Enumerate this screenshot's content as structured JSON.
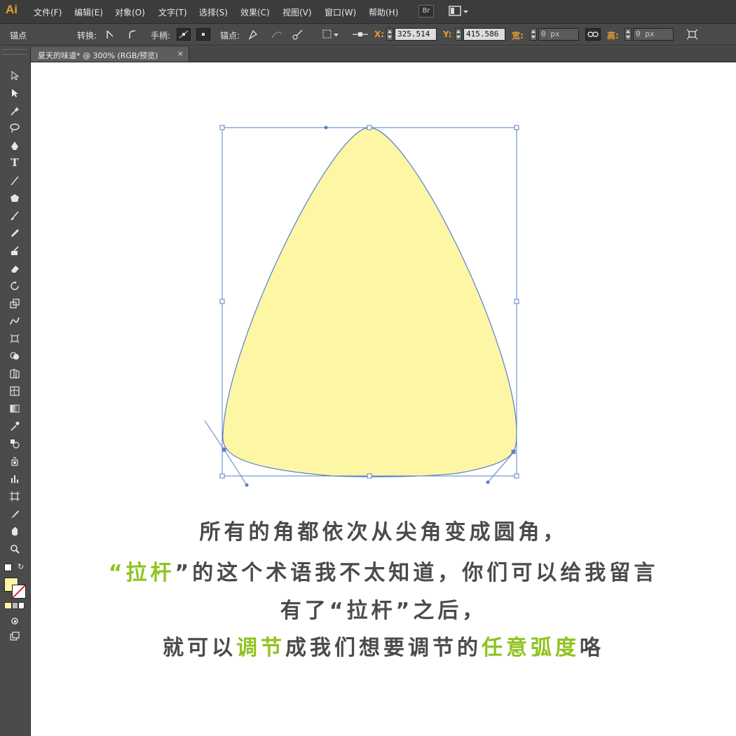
{
  "app": {
    "logo": "Ai",
    "bridge_label": "Br"
  },
  "menubar": {
    "items": [
      "文件(F)",
      "编辑(E)",
      "对象(O)",
      "文字(T)",
      "选择(S)",
      "效果(C)",
      "视图(V)",
      "窗口(W)",
      "帮助(H)"
    ]
  },
  "control_bar": {
    "anchor_label": "锚点",
    "convert_label": "转换:",
    "handles_label": "手柄:",
    "anchors_label": "锚点:",
    "x_label": "X:",
    "x_value": "325.514",
    "y_label": "Y:",
    "y_value": "415.586",
    "width_label": "宽:",
    "width_value": "0 px",
    "height_label": "高:",
    "height_value": "0 px"
  },
  "document_tab": {
    "title": "夏天的味道* @ 300% (RGB/预览)",
    "close": "×"
  },
  "colors": {
    "fill": "#fdf7a5",
    "stroke": "#5a7fcc",
    "accent": "#8fc31f",
    "caption": "#4b4b4b"
  },
  "caption": {
    "line1": "所有的角都依次从尖角变成圆角，",
    "line2": {
      "q_open": "“",
      "term": "拉杆",
      "q_close": "”",
      "rest": "的这个术语我不太知道，你们可以给我留言"
    },
    "line3": {
      "pre": "有了“",
      "term": "拉杆",
      "post": "”之后，"
    },
    "line4": {
      "pre": "就可以",
      "hl1": "调节",
      "mid": "成我们想要调节的",
      "hl2": "任意弧度",
      "end": "咯"
    }
  },
  "tools": [
    "selection-tool-icon",
    "direct-selection-tool-icon",
    "magic-wand-icon",
    "lasso-icon",
    "pen-icon",
    "type-icon",
    "line-segment-icon",
    "ellipse-icon",
    "paintbrush-icon",
    "pencil-icon",
    "blob-brush-icon",
    "eraser-icon",
    "rotate-icon",
    "scale-icon",
    "warp-icon",
    "free-transform-icon",
    "shape-builder-icon",
    "perspective-grid-icon",
    "mesh-icon",
    "gradient-icon",
    "eyedropper-icon",
    "blend-icon",
    "symbol-sprayer-icon",
    "column-graph-icon",
    "artboard-icon",
    "slice-icon",
    "hand-icon",
    "zoom-icon"
  ]
}
